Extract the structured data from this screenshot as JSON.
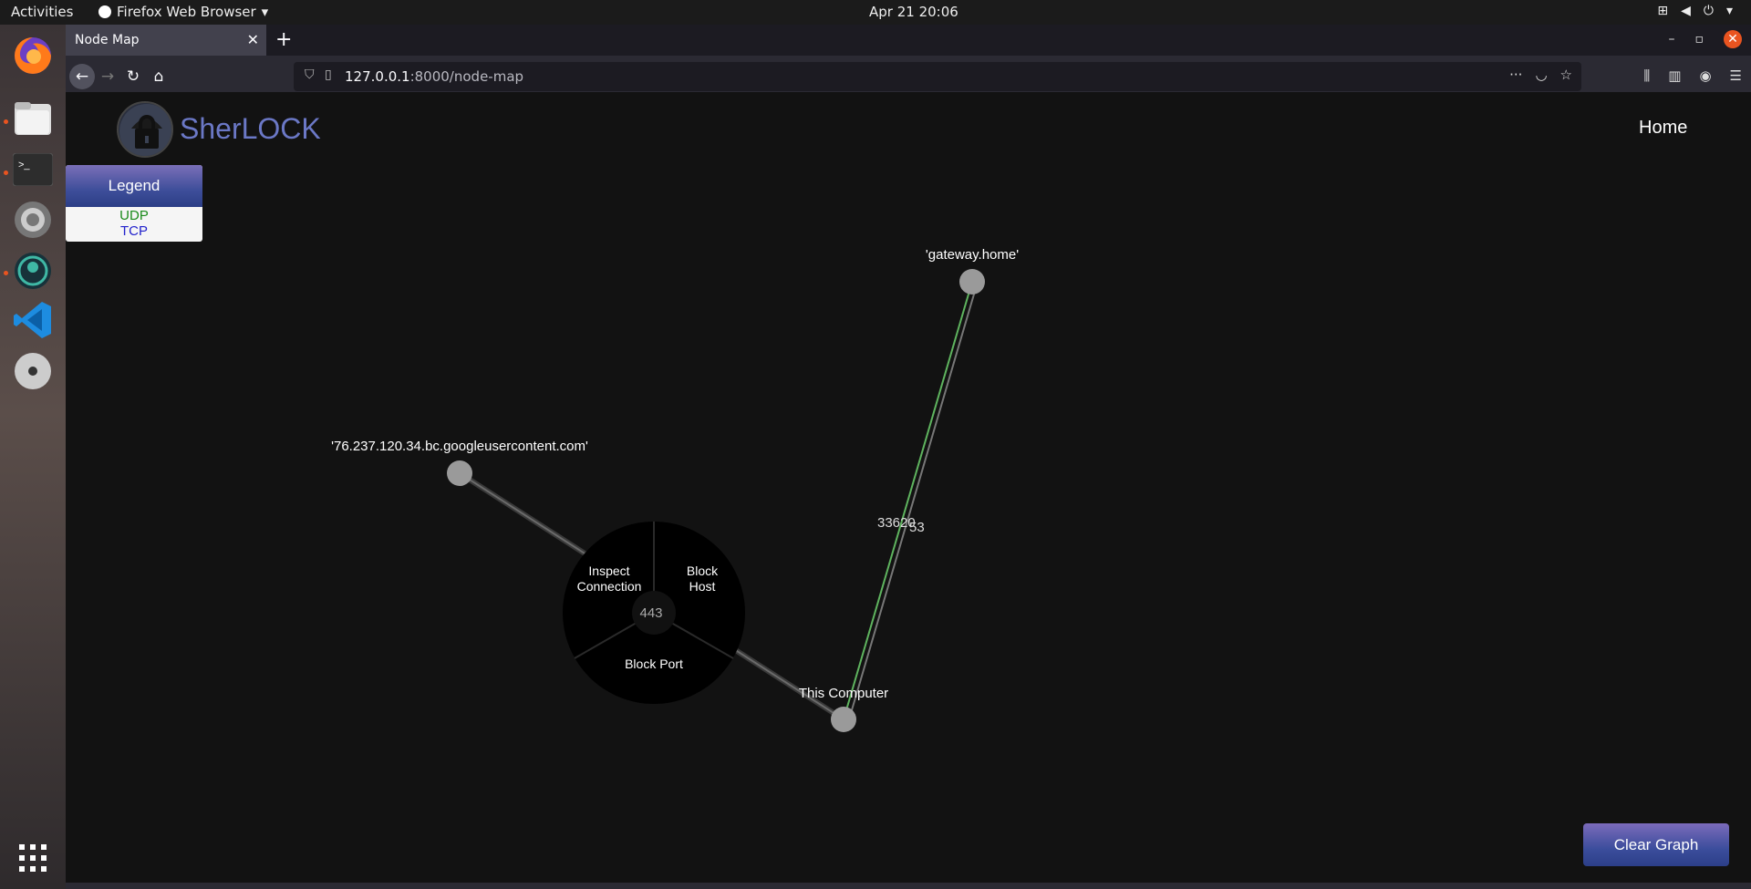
{
  "system": {
    "activities": "Activities",
    "app_name": "Firefox Web Browser",
    "clock": "Apr 21  20:06"
  },
  "browser": {
    "tab_title": "Node Map",
    "url_host": "127.0.0.1",
    "url_rest": ":8000/node-map"
  },
  "page": {
    "brand": "SherLOCK",
    "nav_home": "Home",
    "legend": {
      "title": "Legend",
      "udp": "UDP",
      "tcp": "TCP",
      "udp_color": "#1a8a1a",
      "tcp_color": "#2222cc"
    },
    "clear_button": "Clear Graph"
  },
  "graph": {
    "nodes": {
      "gateway": "'gateway.home'",
      "google": "'76.237.120.34.bc.googleusercontent.com'",
      "computer": "This Computer"
    },
    "edge_labels": {
      "udp_port": "33620",
      "dns_port": "53",
      "tcp_port": "443"
    },
    "menu": {
      "inspect_line1": "Inspect",
      "inspect_line2": "Connection",
      "block_host_line1": "Block",
      "block_host_line2": "Host",
      "block_port": "Block Port",
      "center": "443"
    }
  }
}
